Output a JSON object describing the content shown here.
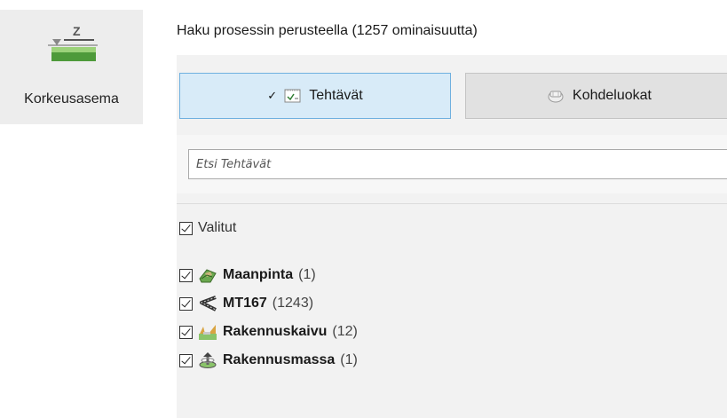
{
  "tool": {
    "label": "Korkeusasema",
    "icon_letter": "Z"
  },
  "heading": "Haku prosessin perusteella (1257 ominaisuutta)",
  "tabs": [
    {
      "label": "Tehtävät",
      "active": true,
      "check": "✓"
    },
    {
      "label": "Kohdeluokat",
      "active": false
    }
  ],
  "search": {
    "placeholder": "Etsi Tehtävät",
    "value": ""
  },
  "select_all": {
    "label": "Valitut",
    "checked": true
  },
  "items": [
    {
      "name": "Maanpinta",
      "count": "(1)",
      "checked": true,
      "icon": "terrain-icon"
    },
    {
      "name": "MT167",
      "count": "(1243)",
      "checked": true,
      "icon": "road-icon"
    },
    {
      "name": "Rakennuskaivu",
      "count": "(12)",
      "checked": true,
      "icon": "excavation-icon"
    },
    {
      "name": "Rakennusmassa",
      "count": "(1)",
      "checked": true,
      "icon": "mass-icon"
    }
  ],
  "colors": {
    "active_tab_bg": "#d8ebf8",
    "active_tab_border": "#6fb0df",
    "panel_bg": "#f2f2f2",
    "terrain_green": "#6aa84f"
  }
}
